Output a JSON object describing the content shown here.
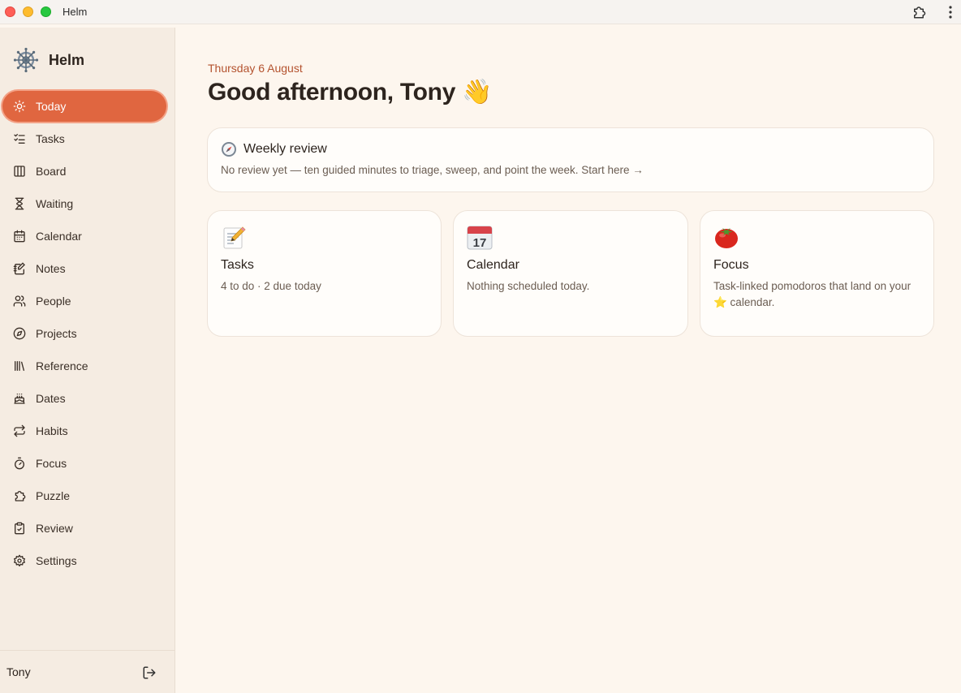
{
  "window": {
    "title": "Helm"
  },
  "brand": {
    "name": "Helm"
  },
  "nav": [
    {
      "label": "Today",
      "icon": "sun-icon",
      "active": true
    },
    {
      "label": "Tasks",
      "icon": "list-checks-icon"
    },
    {
      "label": "Board",
      "icon": "columns-icon"
    },
    {
      "label": "Waiting",
      "icon": "hourglass-icon"
    },
    {
      "label": "Calendar",
      "icon": "calendar-icon"
    },
    {
      "label": "Notes",
      "icon": "notebook-icon"
    },
    {
      "label": "People",
      "icon": "people-icon"
    },
    {
      "label": "Projects",
      "icon": "compass-icon"
    },
    {
      "label": "Reference",
      "icon": "library-icon"
    },
    {
      "label": "Dates",
      "icon": "cake-icon"
    },
    {
      "label": "Habits",
      "icon": "repeat-icon"
    },
    {
      "label": "Focus",
      "icon": "timer-icon"
    },
    {
      "label": "Puzzle",
      "icon": "puzzle-icon"
    },
    {
      "label": "Review",
      "icon": "clipboard-icon"
    },
    {
      "label": "Settings",
      "icon": "gear-icon"
    }
  ],
  "user": {
    "name": "Tony"
  },
  "main": {
    "date": "Thursday 6 August",
    "greeting": "Good afternoon, Tony 👋",
    "review": {
      "title": "Weekly review",
      "text": "No review yet — ten guided minutes to triage, sweep, and point the week. Start here →"
    },
    "tiles": [
      {
        "title": "Tasks",
        "subtitle": "4 to do · 2 due today",
        "icon": "memo-emoji-icon"
      },
      {
        "title": "Calendar",
        "subtitle": "Nothing scheduled today.",
        "icon": "calendar-emoji-icon"
      },
      {
        "title": "Focus",
        "subtitle": "Task-linked pomodoros that land on your ⭐ calendar.",
        "icon": "tomato-emoji-icon"
      }
    ]
  },
  "colors": {
    "accent": "#e06640",
    "sidebar": "#f5ece2",
    "background": "#fdf6ee",
    "date": "#b4532f"
  }
}
